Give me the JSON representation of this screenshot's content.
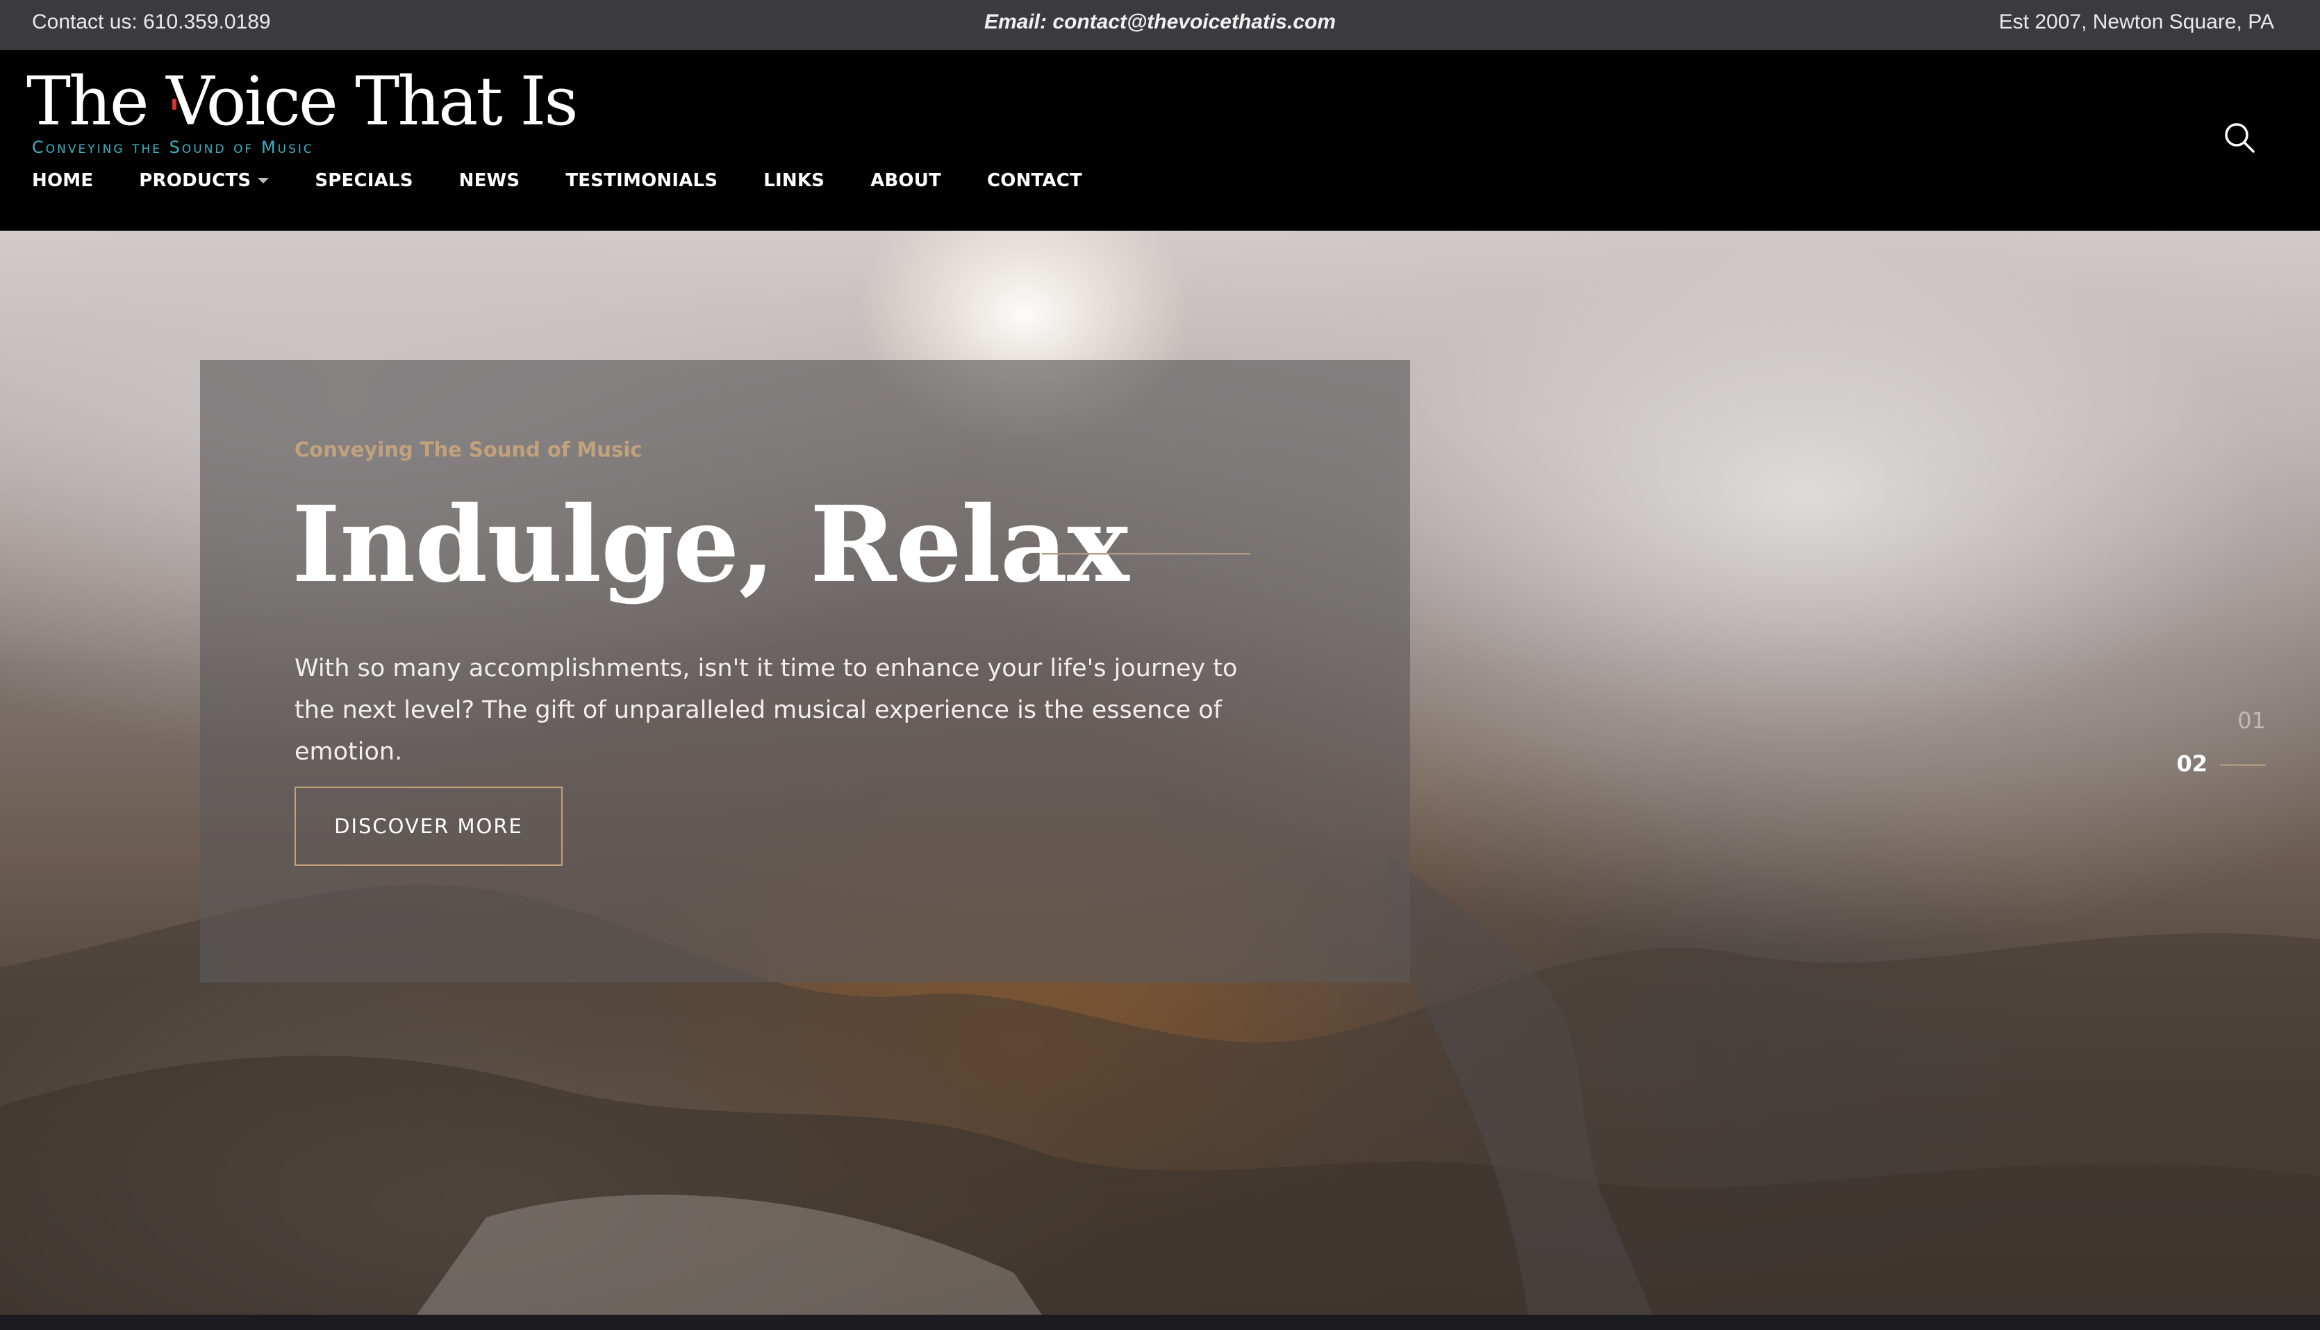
{
  "topbar": {
    "contact": "Contact us: 610.359.0189",
    "email": "Email: contact@thevoicethatis.com",
    "est": "Est  2007, Newton Square, PA"
  },
  "logo": {
    "title": "The Voice That Is",
    "tagline": "Conveying the Sound of Music"
  },
  "nav": {
    "items": [
      {
        "label": "HOME"
      },
      {
        "label": "PRODUCTS",
        "has_dropdown": true
      },
      {
        "label": "SPECIALS"
      },
      {
        "label": "NEWS"
      },
      {
        "label": "TESTIMONIALS"
      },
      {
        "label": "LINKS"
      },
      {
        "label": "ABOUT"
      },
      {
        "label": "CONTACT"
      }
    ],
    "search_icon": "search-icon"
  },
  "hero": {
    "eyebrow": "Conveying The Sound of Music",
    "title": "Indulge, Relax",
    "text": "With so many accomplishments, isn't it time to enhance your life's journey to the next level? The gift of unparalleled musical experience is the essence of emotion.",
    "cta": "DISCOVER MORE",
    "slides": [
      "01",
      "02"
    ],
    "active_slide": "02"
  },
  "colors": {
    "topbar_bg": "#3b3b3d",
    "header_bg": "#000000",
    "accent_gold": "#c2a27c",
    "logo_teal": "#3ab3c4",
    "logo_red": "#d43434"
  }
}
